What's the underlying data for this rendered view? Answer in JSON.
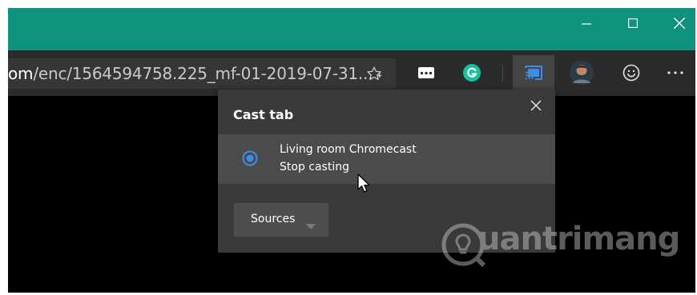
{
  "colors": {
    "titlebar": "#0f937e",
    "toolbar": "#2b2b2b",
    "popup_bg": "#3a3a3a",
    "selected_row": "#4b4b4b",
    "radio_accent": "#3d8ee6",
    "grammarly": "#15c39a"
  },
  "window_controls": {
    "icons": [
      "minimize-icon",
      "maximize-icon",
      "close-icon"
    ]
  },
  "address_bar": {
    "domain_tail": "om",
    "path": "/enc/1564594758.225_mf-01-2019-07-31..."
  },
  "toolbar": {
    "icons": [
      "favorite-star-icon",
      "extension-icon",
      "grammarly-icon",
      "cast-icon",
      "profile-avatar",
      "emoji-feedback-icon",
      "more-options-icon"
    ]
  },
  "cast_popup": {
    "title": "Cast tab",
    "device": {
      "name": "Living room Chromecast",
      "status": "Stop casting",
      "selected": true
    },
    "sources_label": "Sources"
  },
  "watermark": {
    "text": "uantrimang"
  }
}
